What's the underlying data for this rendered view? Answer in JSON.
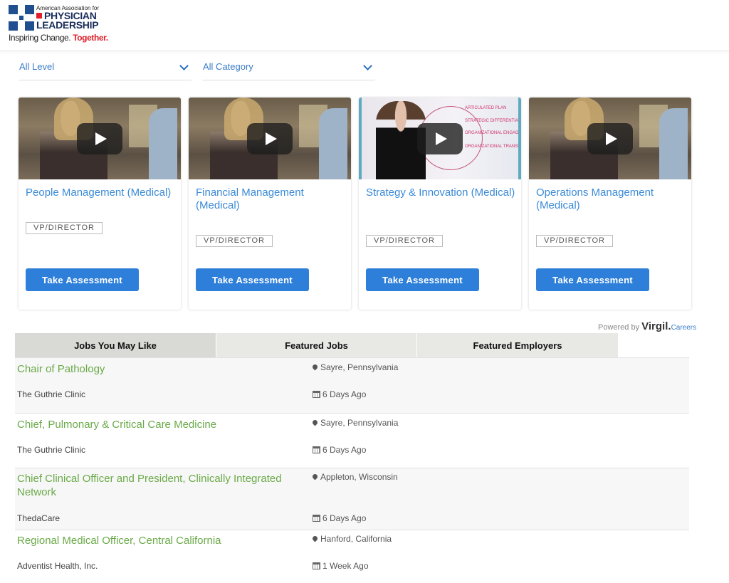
{
  "logo": {
    "line1": "American Association for",
    "line2": "PHYSICIAN",
    "line3": "LEADERSHIP",
    "tagline_a": "Inspiring Change.",
    "tagline_b": "Together."
  },
  "filters": [
    {
      "label": "All Level"
    },
    {
      "label": "All Category"
    }
  ],
  "cards": [
    {
      "title": "People Management (Medical)",
      "level": "VP/DIRECTOR",
      "button": "Take Assessment"
    },
    {
      "title": "Financial Management (Medical)",
      "level": "VP/DIRECTOR",
      "button": "Take Assessment"
    },
    {
      "title": "Strategy & Innovation (Medical)",
      "level": "VP/DIRECTOR",
      "button": "Take Assessment"
    },
    {
      "title": "Operations Management (Medical)",
      "level": "VP/DIRECTOR",
      "button": "Take Assessment"
    }
  ],
  "whiteboard": [
    "ARTICULATED PLAN",
    "STRATEGIC DIFFERENTIATION",
    "ORGANIZATIONAL ENGAGE",
    "ORGANIZATIONAL TRANSF"
  ],
  "powered_by": {
    "prefix": "Powered by",
    "brand": "Virgil.",
    "suffix": "Careers"
  },
  "tabs": [
    {
      "label": "Jobs You May Like",
      "active": true
    },
    {
      "label": "Featured Jobs",
      "active": false
    },
    {
      "label": "Featured Employers",
      "active": false
    }
  ],
  "jobs": [
    {
      "title": "Chair of Pathology",
      "employer": "The Guthrie Clinic",
      "location": "Sayre, Pennsylvania",
      "posted": "6 Days Ago"
    },
    {
      "title": "Chief, Pulmonary & Critical Care Medicine",
      "employer": "The Guthrie Clinic",
      "location": "Sayre, Pennsylvania",
      "posted": "6 Days Ago"
    },
    {
      "title": "Chief Clinical Officer and President, Clinically Integrated Network",
      "employer": "ThedaCare",
      "location": "Appleton, Wisconsin",
      "posted": "6 Days Ago"
    },
    {
      "title": "Regional Medical Officer, Central California",
      "employer": "Adventist Health, Inc.",
      "location": "Hanford, California",
      "posted": "1 Week Ago"
    }
  ]
}
